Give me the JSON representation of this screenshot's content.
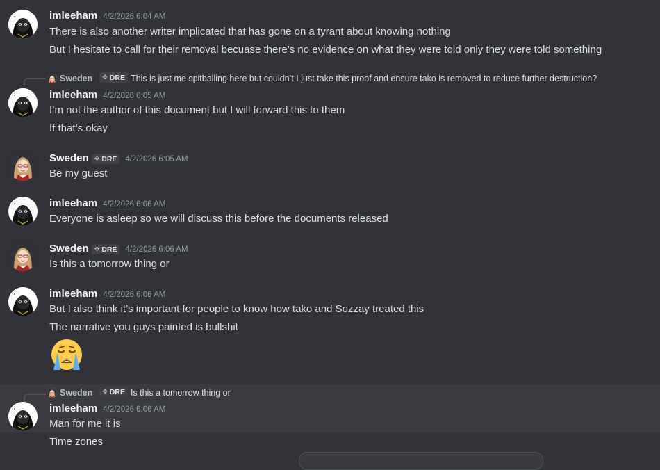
{
  "users": {
    "imleeham": "imleeham",
    "sweden": "Sweden",
    "sweden_tag": "DRE"
  },
  "messages": [
    {
      "author": "imleeham",
      "timestamp": "4/2/2026 6:04 AM",
      "lines": [
        "There is also another writer implicated that has gone on a tyrant about knowing nothing",
        "But I hesitate to call for their removal becuase there’s no evidence on what they were told only they were told something"
      ]
    },
    {
      "reply_to": {
        "author": "Sweden",
        "tag": "DRE",
        "text": "This is just me spitballing here but couldn’t I just take this proof and ensure tako is removed to reduce further destruction?"
      },
      "author": "imleeham",
      "timestamp": "4/2/2026 6:05 AM",
      "lines": [
        "I’m not the author of this document but I will forward this to them",
        "If that’s okay"
      ]
    },
    {
      "author": "Sweden",
      "tag": "DRE",
      "timestamp": "4/2/2026 6:05 AM",
      "lines": [
        "Be my guest"
      ]
    },
    {
      "author": "imleeham",
      "timestamp": "4/2/2026 6:06 AM",
      "lines": [
        "Everyone is asleep so we will discuss this before the documents released"
      ]
    },
    {
      "author": "Sweden",
      "tag": "DRE",
      "timestamp": "4/2/2026 6:06 AM",
      "lines": [
        "Is this a tomorrow thing or"
      ]
    },
    {
      "author": "imleeham",
      "timestamp": "4/2/2026 6:06 AM",
      "lines": [
        "But I also think it’s important for people to know how tako and Sozzay treated this",
        "The narrative you guys painted is bullshit"
      ],
      "emoji": "loudly-crying-face"
    },
    {
      "reply_to": {
        "author": "Sweden",
        "tag": "DRE",
        "text": "Is this a tomorrow thing or"
      },
      "author": "imleeham",
      "timestamp": "4/2/2026 6:06 AM",
      "lines": [
        "Man for me it is",
        "Time zones"
      ]
    }
  ],
  "colors": {
    "background": "#313338",
    "highlight": "#393b41",
    "text": "#dbdee1",
    "muted": "#949ba4"
  }
}
